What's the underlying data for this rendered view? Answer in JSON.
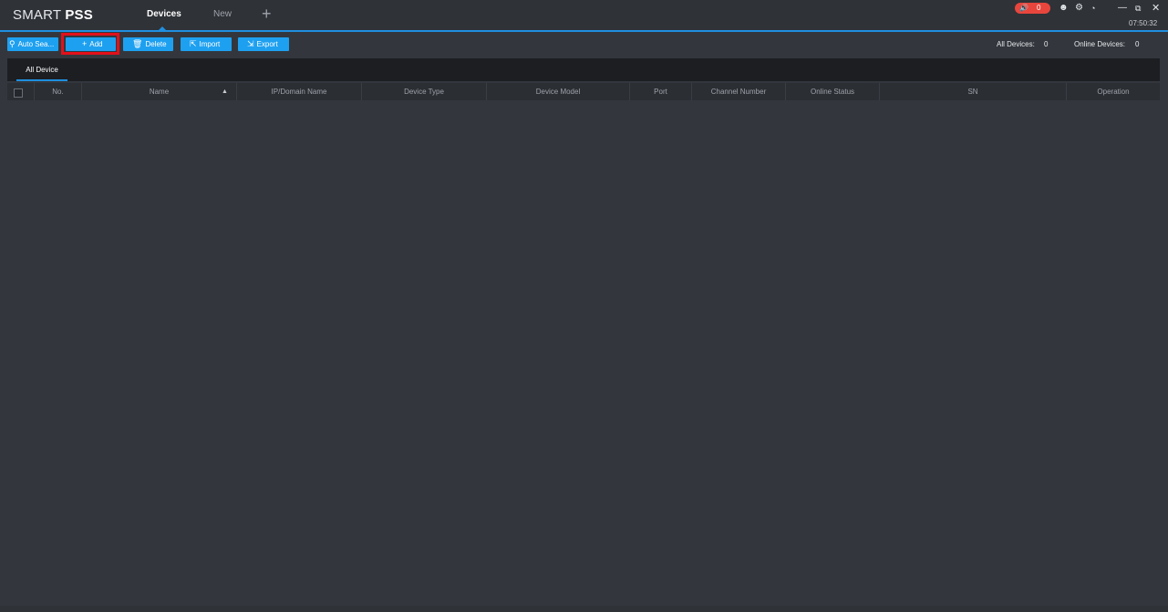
{
  "app": {
    "logo_light": "SMART ",
    "logo_bold": "PSS"
  },
  "tabs": {
    "devices": "Devices",
    "new": "New",
    "add": "+"
  },
  "topbar": {
    "alarm_count": "0",
    "clock": "07:50:32",
    "icons": [
      "speaker-icon",
      "user-icon",
      "gear-icon",
      "gauge-icon",
      "minimize-icon",
      "restore-icon",
      "close-icon"
    ]
  },
  "toolbar": {
    "auto_search": "Auto Sea...",
    "add": "Add",
    "delete": "Delete",
    "import": "Import",
    "export": "Export"
  },
  "stats": {
    "all_devices_label": "All Devices:",
    "all_devices_value": "0",
    "online_devices_label": "Online Devices:",
    "online_devices_value": "0"
  },
  "category": {
    "all_device": "All Device"
  },
  "table": {
    "columns": [
      "No.",
      "Name",
      "IP/Domain Name",
      "Device Type",
      "Device Model",
      "Port",
      "Channel Number",
      "Online Status",
      "SN",
      "Operation"
    ],
    "rows": []
  },
  "colors": {
    "accent": "#1ea0f0",
    "highlight": "#e3101a",
    "alarm": "#e8463d",
    "background": "#33373d"
  }
}
